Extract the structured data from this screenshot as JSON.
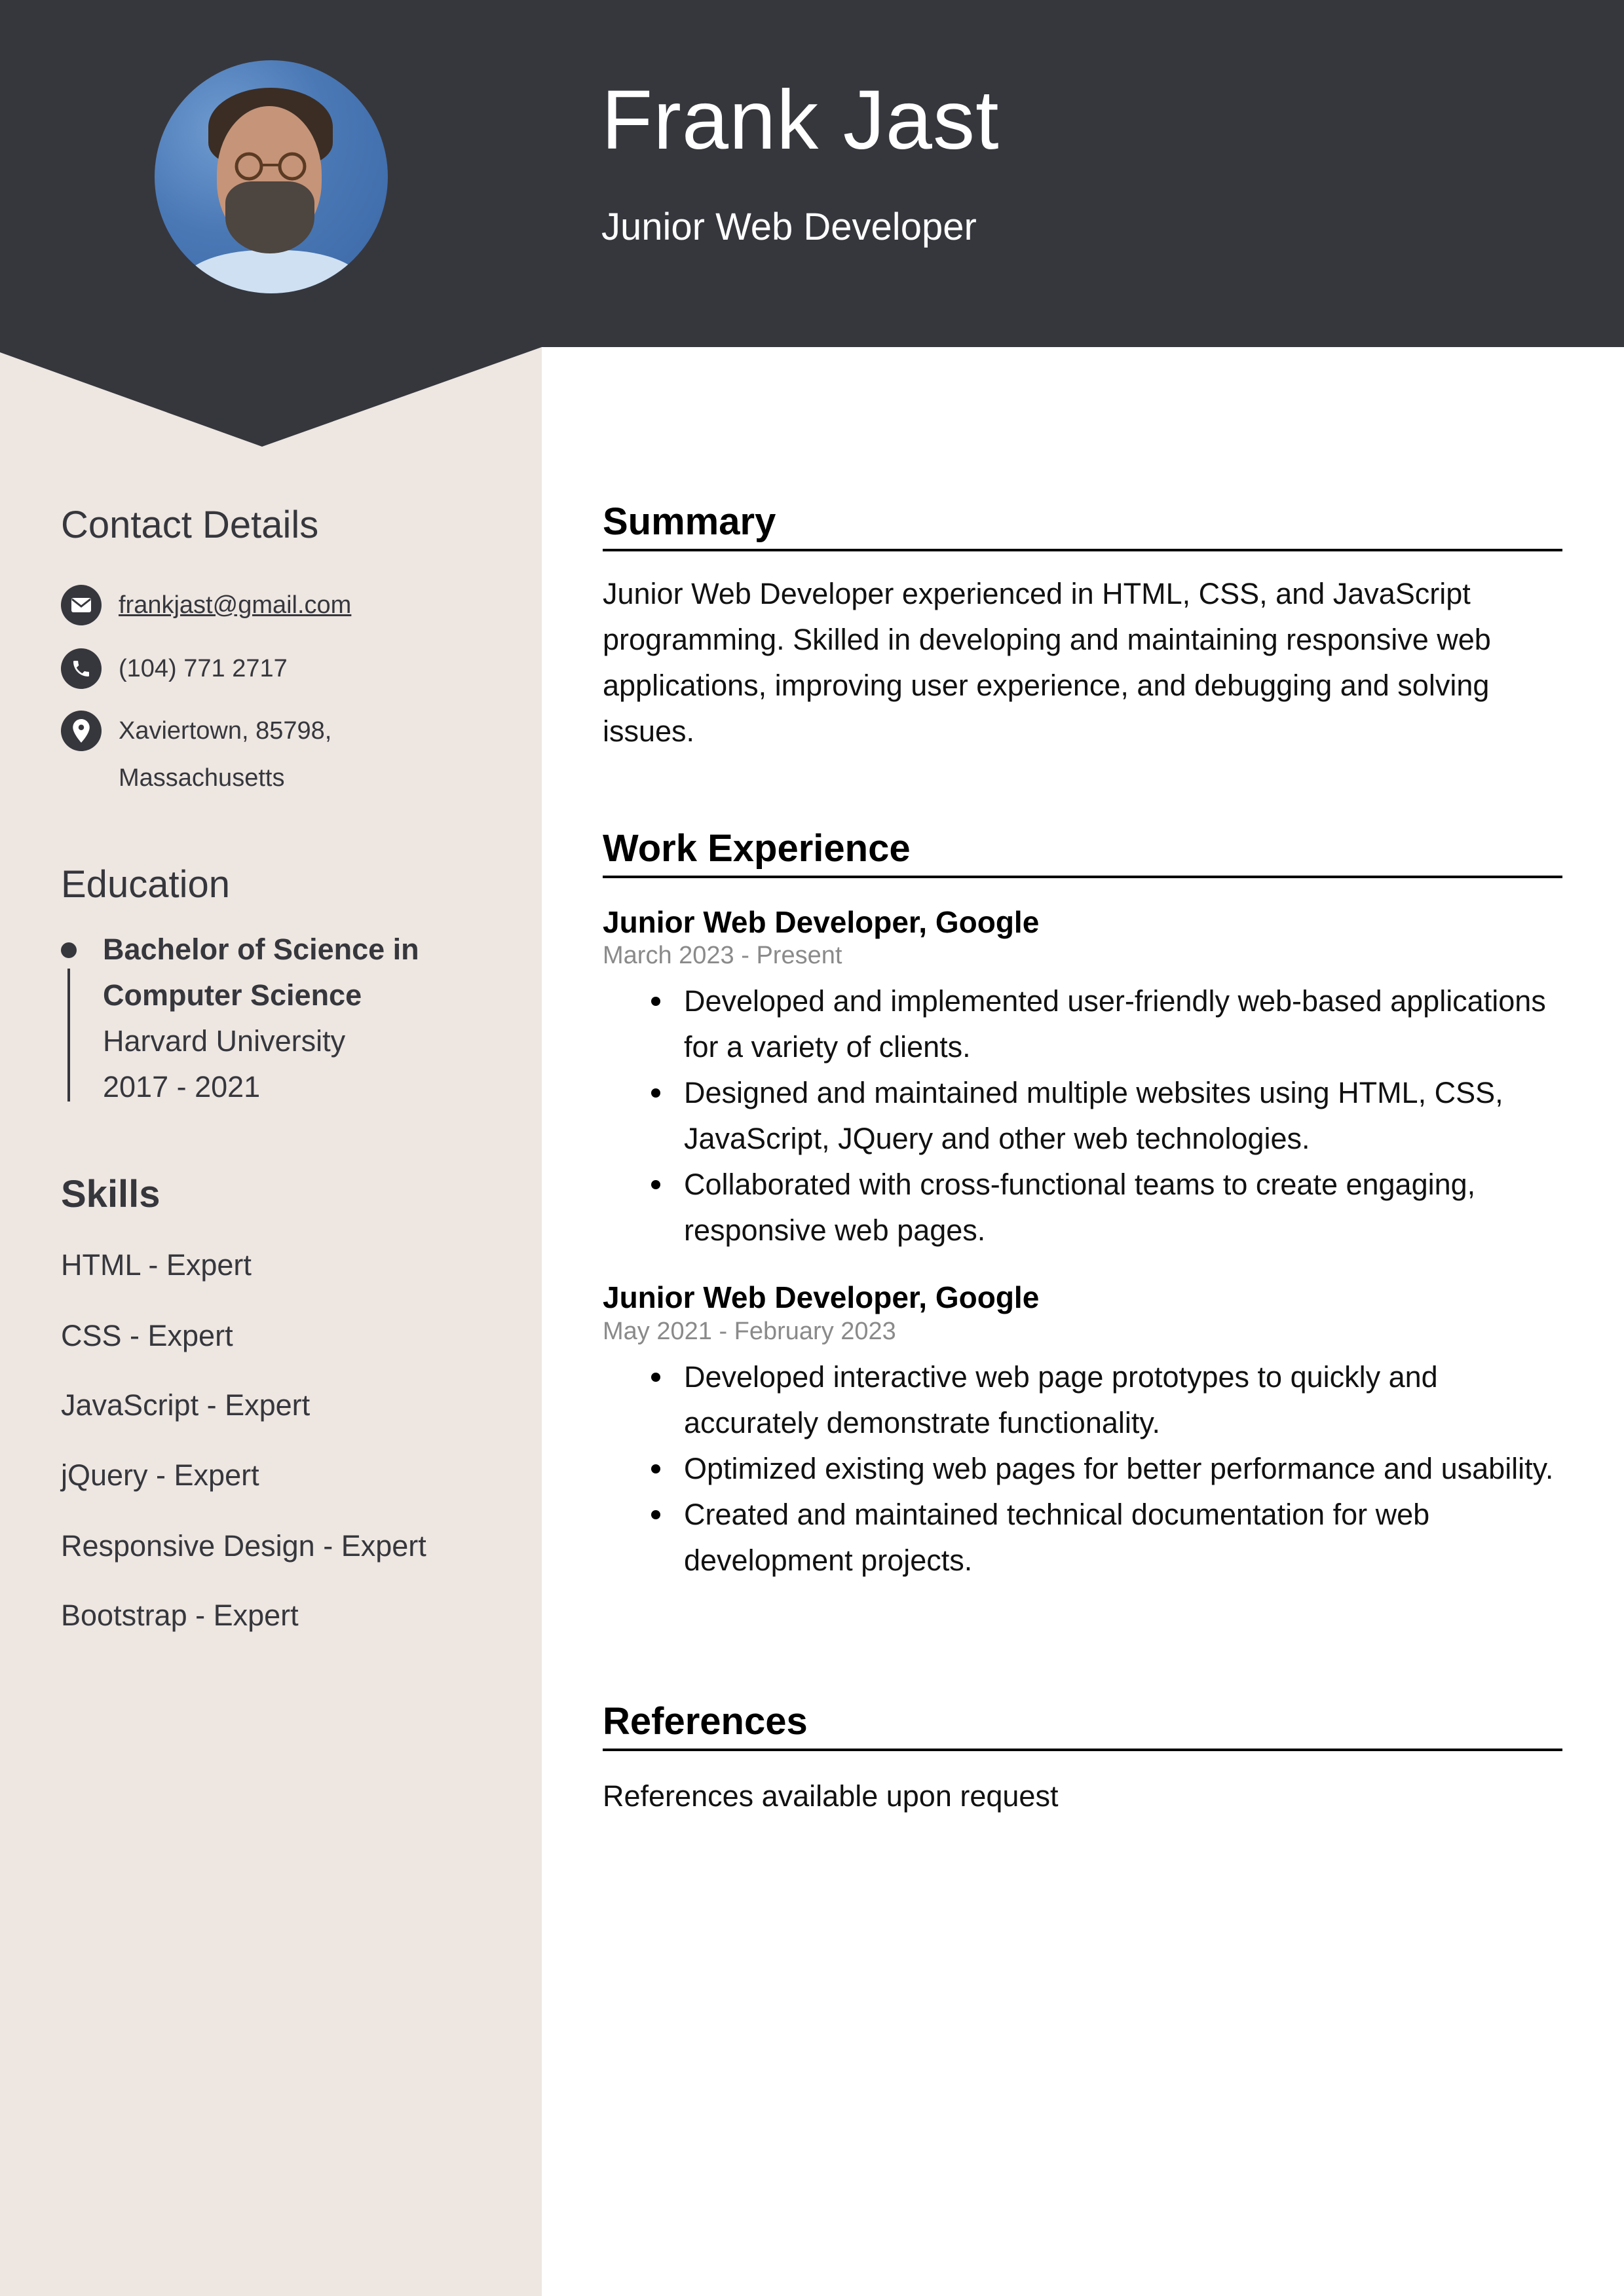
{
  "header": {
    "name": "Frank Jast",
    "role": "Junior Web Developer",
    "photo_alt": "profile-photo"
  },
  "colors": {
    "dark": "#36373d",
    "sidebar_bg": "#ede6e1",
    "date_gray": "#8a8a8a"
  },
  "sidebar": {
    "contact": {
      "heading": "Contact Details",
      "email": "frankjast@gmail.com",
      "phone": "(104) 771 2717",
      "address_line1": "Xaviertown, 85798,",
      "address_line2": "Massachusetts"
    },
    "education": {
      "heading": "Education",
      "items": [
        {
          "degree": "Bachelor of Science in Computer Science",
          "school": "Harvard University",
          "years": "2017 - 2021"
        }
      ]
    },
    "skills": {
      "heading": "Skills",
      "items": [
        "HTML - Expert",
        "CSS - Expert",
        "JavaScript - Expert",
        "jQuery - Expert",
        "Responsive Design - Expert",
        "Bootstrap - Expert"
      ]
    }
  },
  "main": {
    "summary": {
      "heading": "Summary",
      "text": "Junior Web Developer experienced in HTML, CSS, and JavaScript programming. Skilled in developing and maintaining responsive web applications, improving user experience, and debugging and solving issues."
    },
    "work": {
      "heading": "Work Experience",
      "jobs": [
        {
          "title": "Junior Web Developer, Google",
          "dates": "March 2023 - Present",
          "bullets": [
            "Developed and implemented user-friendly web-based applications for a variety of clients.",
            "Designed and maintained multiple websites using HTML, CSS, JavaScript, JQuery and other web technologies.",
            "Collaborated with cross-functional teams to create engaging, responsive web pages."
          ]
        },
        {
          "title": "Junior Web Developer, Google",
          "dates": "May 2021 - February 2023",
          "bullets": [
            "Developed interactive web page prototypes to quickly and accurately demonstrate functionality.",
            "Optimized existing web pages for better performance and usability.",
            "Created and maintained technical documentation for web development projects."
          ]
        }
      ]
    },
    "references": {
      "heading": "References",
      "text": "References available upon request"
    }
  },
  "icons": {
    "email": "envelope-icon",
    "phone": "phone-icon",
    "address": "map-pin-icon"
  }
}
